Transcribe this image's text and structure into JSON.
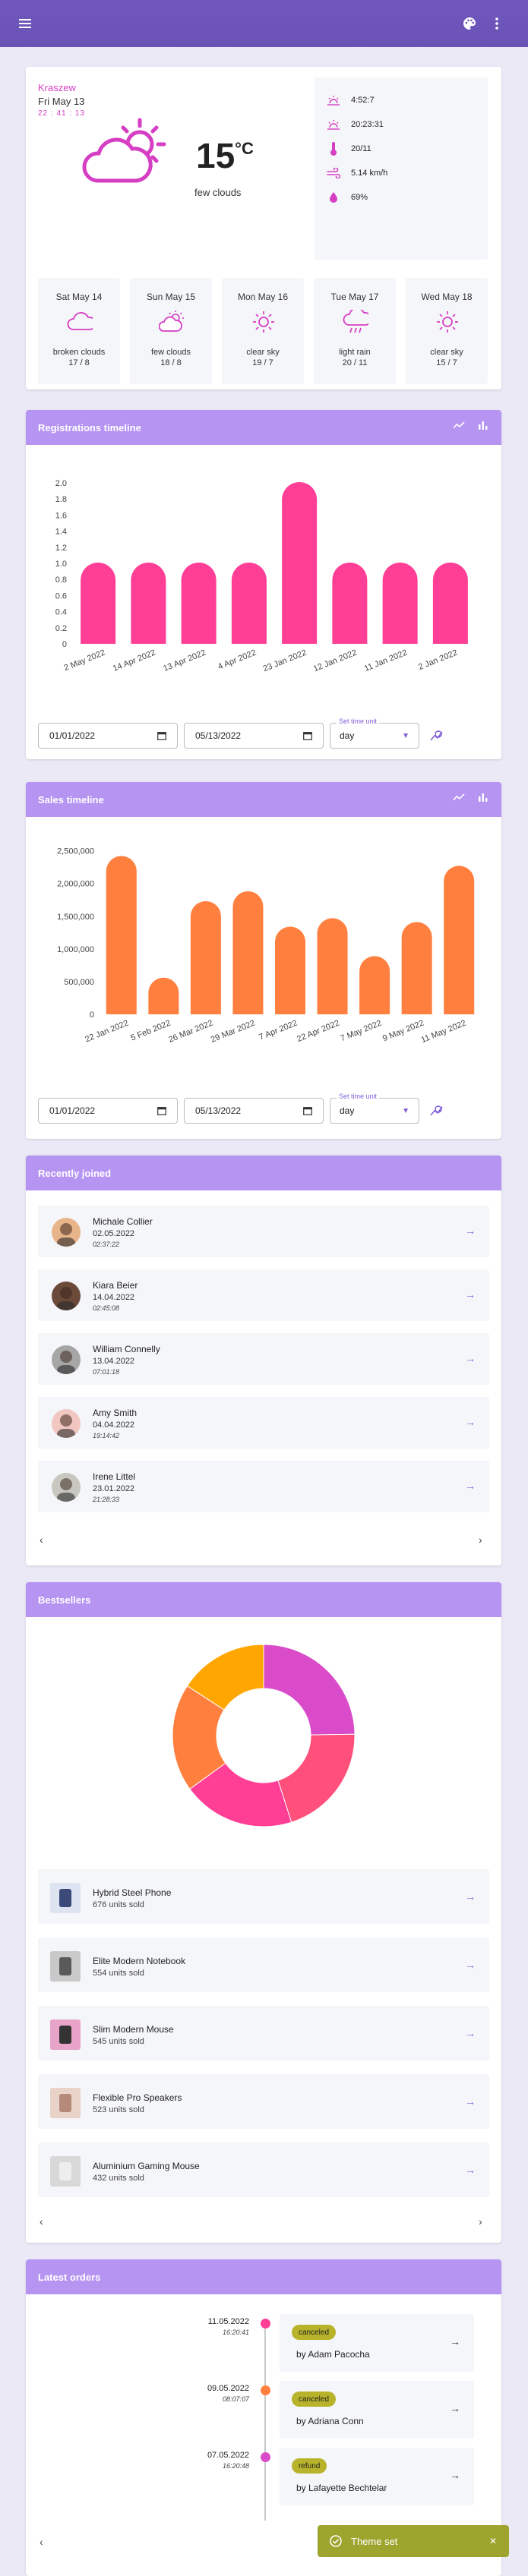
{
  "colors": {
    "topbar": "#6a52b6",
    "accent": "#d63ec4",
    "card_header": "#b594f2",
    "bar_pink": "#ff3e96",
    "bar_orange": "#ff7f3e",
    "badge": "#b8b32b",
    "toast": "#9ea52f"
  },
  "topbar": {
    "menu_icon": "hamburger-menu-icon",
    "theme_icon": "palette-icon",
    "more_icon": "more-vertical-icon"
  },
  "weather": {
    "city": "Kraszew",
    "date": "Fri May 13",
    "time": "22 : 41 : 13",
    "temperature": "15",
    "unit": "°C",
    "description": "few clouds",
    "details": [
      {
        "icon": "sunrise-icon",
        "value": "4:52:7"
      },
      {
        "icon": "sunset-icon",
        "value": "20:23:31"
      },
      {
        "icon": "thermometer-icon",
        "value": "20/11"
      },
      {
        "icon": "wind-icon",
        "value": "5.14 km/h"
      },
      {
        "icon": "humidity-icon",
        "value": "69%"
      }
    ],
    "forecast": [
      {
        "day": "Sat May 14",
        "desc": "broken clouds",
        "temps": "17 / 8",
        "icon": "cloud-icon"
      },
      {
        "day": "Sun May 15",
        "desc": "few clouds",
        "temps": "18 / 8",
        "icon": "partly-cloudy-icon"
      },
      {
        "day": "Mon May 16",
        "desc": "clear sky",
        "temps": "19 / 7",
        "icon": "sun-icon"
      },
      {
        "day": "Tue May 17",
        "desc": "light rain",
        "temps": "20 / 11",
        "icon": "rain-icon"
      },
      {
        "day": "Wed May 18",
        "desc": "clear sky",
        "temps": "15 / 7",
        "icon": "sun-icon"
      }
    ]
  },
  "registrations": {
    "title": "Registrations timeline",
    "date_from": "01/01/2022",
    "date_to": "05/13/2022",
    "unit_label": "Set time unit",
    "unit_value": "day",
    "chart_data": {
      "type": "bar",
      "categories": [
        "2 May 2022",
        "14 Apr 2022",
        "13 Apr 2022",
        "4 Apr 2022",
        "23 Jan 2022",
        "12 Jan 2022",
        "11 Jan 2022",
        "2 Jan 2022"
      ],
      "values": [
        1,
        1,
        1,
        1,
        2,
        1,
        1,
        1
      ],
      "ylim": [
        0,
        2
      ],
      "yticks": [
        "0",
        "0.2",
        "0.4",
        "0.6",
        "0.8",
        "1.0",
        "1.2",
        "1.4",
        "1.6",
        "1.8",
        "2.0"
      ],
      "color": "#ff3e96"
    }
  },
  "sales": {
    "title": "Sales timeline",
    "date_from": "01/01/2022",
    "date_to": "05/13/2022",
    "unit_label": "Set time unit",
    "unit_value": "day",
    "chart_data": {
      "type": "bar",
      "categories": [
        "22 Jan 2022",
        "5 Feb 2022",
        "26 Mar 2022",
        "29 Mar 2022",
        "7 Apr 2022",
        "22 Apr 2022",
        "7 May 2022",
        "9 May 2022",
        "11 May 2022"
      ],
      "values": [
        2420000,
        560000,
        1730000,
        1880000,
        1340000,
        1470000,
        890000,
        1410000,
        2270000
      ],
      "ylim": [
        0,
        2600000
      ],
      "yticks": [
        "0",
        "500,000",
        "1,000,000",
        "1,500,000",
        "2,000,000",
        "2,500,000"
      ],
      "color": "#ff7f3e"
    }
  },
  "recent": {
    "title": "Recently joined",
    "users": [
      {
        "name": "Michale Collier",
        "date": "02.05.2022",
        "time": "02:37:22"
      },
      {
        "name": "Kiara Beier",
        "date": "14.04.2022",
        "time": "02:45:08"
      },
      {
        "name": "William Connelly",
        "date": "13.04.2022",
        "time": "07:01:18"
      },
      {
        "name": "Amy Smith",
        "date": "04.04.2022",
        "time": "19:14:42"
      },
      {
        "name": "Irene Littel",
        "date": "23.01.2022",
        "time": "21:28:33"
      }
    ]
  },
  "bestsellers": {
    "title": "Bestsellers",
    "chart_data": {
      "type": "pie",
      "values": [
        676,
        554,
        545,
        523,
        432
      ],
      "colors": [
        "#d94bc9",
        "#ff4f7b",
        "#ff3e96",
        "#ff7f3e",
        "#ffa600"
      ]
    },
    "products": [
      {
        "name": "Hybrid Steel Phone",
        "sold": "676 units sold"
      },
      {
        "name": "Elite Modern Notebook",
        "sold": "554 units sold"
      },
      {
        "name": "Slim Modern Mouse",
        "sold": "545 units sold"
      },
      {
        "name": "Flexible Pro Speakers",
        "sold": "523 units sold"
      },
      {
        "name": "Aluminium Gaming Mouse",
        "sold": "432 units sold"
      }
    ]
  },
  "orders": {
    "title": "Latest orders",
    "items": [
      {
        "date": "11.05.2022",
        "time": "16:20:41",
        "status": "canceled",
        "by": "by Adam Pacocha",
        "dot": "#ff3e96"
      },
      {
        "date": "09.05.2022",
        "time": "08:07:07",
        "status": "canceled",
        "by": "by Adriana Conn",
        "dot": "#ff7f3e"
      },
      {
        "date": "07.05.2022",
        "time": "16:20:48",
        "status": "refund",
        "by": "by Lafayette Bechtelar",
        "dot": "#d94bc9"
      }
    ]
  },
  "toast": {
    "message": "Theme set"
  },
  "icons": {
    "arrow": "→",
    "prev": "‹",
    "next": "›",
    "close": "✕"
  }
}
